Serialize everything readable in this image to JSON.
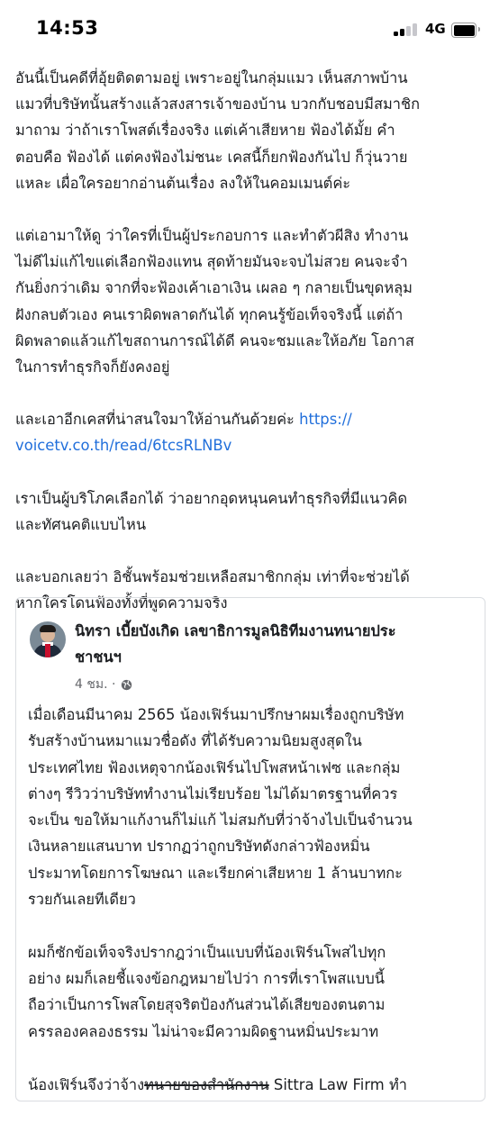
{
  "status_bar": {
    "time": "14:53",
    "network": "4G",
    "signal_bars_active": 2,
    "signal_bars_total": 4,
    "battery_level": 1.0
  },
  "post": {
    "paragraph_1": "อันนี้เป็นคดีที่อุ้ยติดตามอยู่ เพราะอยู่ในกลุ่มแมว เห็นสภาพบ้าน\nแมวที่บริษัทนั้นสร้างแล้วสงสารเจ้าของบ้าน บวกกับชอบมีสมาชิก\nมาถาม ว่าถ้าเราโพสต์เรื่องจริง แต่เค้าเสียหาย ฟ้องได้มั้ย คำ\nตอบคือ ฟ้องได้ แต่คงฟ้องไม่ชนะ เคสนี้ก็ยกฟ้องกันไป ก็วุ่นวาย\nแหละ เผื่อใครอยากอ่านต้นเรื่อง ลงให้ในคอมเมนต์ค่ะ",
    "paragraph_2": "แต่เอามาให้ดู ว่าใครที่เป็นผู้ประกอบการ และทำตัวผีสิง ทำงาน\nไม่ดีไม่แก้ไขแต่เลือกฟ้องแทน สุดท้ายมันจะจบไม่สวย คนจะจำ\nกันยิ่งกว่าเดิม จากที่จะฟ้องเค้าเอาเงิน เผลอ ๆ กลายเป็นขุดหลุม\nฝังกลบตัวเอง คนเราผิดพลาดกันได้ ทุกคนรู้ข้อเท็จจริงนี้ แต่ถ้า\nผิดพลาดแล้วแก้ไขสถานการณ์ได้ดี คนจะชมและให้อภัย โอกาส\nในการทำธุรกิจก็ยังคงอยู่",
    "paragraph_3_text": "และเอาอีกเคสที่น่าสนใจมาให้อ่านกันด้วยค่ะ ",
    "paragraph_3_link_a": "https://",
    "paragraph_3_link_b": "voicetv.co.th/read/6tcsRLNBv",
    "paragraph_4": "เราเป็นผู้บริโภคเลือกได้ ว่าอยากอุดหนุนคนทำธุรกิจที่มีแนวคิด\nและทัศนคติแบบไหน",
    "paragraph_5": "และบอกเลยว่า อิชั้นพร้อมช่วยเหลือสมาชิกกลุ่ม เท่าที่จะช่วยได้\nหากใครโดนฟ้องทั้งที่พูดความจริง"
  },
  "shared_post": {
    "author": "นิทรา เบี้ยบังเกิด เลขาธิการมูลนิธิทีมงานทนายประ\nชาชนฯ",
    "time": "4 ชม. ·",
    "paragraph_1": "เมื่อเดือนมีนาคม 2565 น้องเฟิร์นมาปรึกษาผมเรื่องถูกบริษัท\nรับสร้างบ้านหมาแมวชื่อดัง ที่ได้รับความนิยมสูงสุดใน\nประเทศไทย ฟ้องเหตุจากน้องเฟิร์นไปโพสหน้าเฟซ และกลุ่ม\nต่างๆ รีวิวว่าบริษัททำงานไม่เรียบร้อย ไม่ได้มาตรฐานที่ควร\nจะเป็น ขอให้มาแก้งานก็ไม่แก้ ไม่สมกับที่ว่าจ้างไปเป็นจำนวน\nเงินหลายแสนบาท ปรากฏว่าถูกบริษัทดังกล่าวฟ้องหมิ่น\nประมาทโดยการโฆษณา และเรียกค่าเสียหาย 1 ล้านบาทกะ\nรวยกันเลยทีเดียว",
    "paragraph_2": "ผมก็ซักข้อเท็จจริงปรากฎว่าเป็นแบบที่น้องเฟิร์นโพสไปทุก\nอย่าง ผมก็เลยชี้แจงข้อกฎหมายไปว่า การที่เราโพสแบบนี้\nถือว่าเป็นการโพสโดยสุจริตป้องกันส่วนได้เสียของตนตาม\nครรลองคลองธรรม ไม่น่าจะมีความผิดฐานหมิ่นประมาท",
    "paragraph_3_start": "น้องเฟิร์นจึงว่าจ้าง",
    "paragraph_3_strike": "ทนายของสำนักงาน",
    "paragraph_3_end": " Sittra Law Firm ทำ"
  }
}
